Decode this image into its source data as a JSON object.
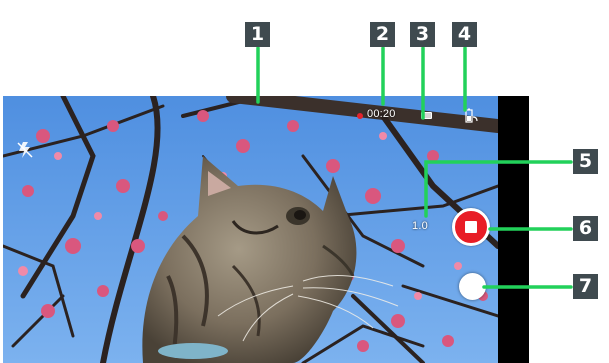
{
  "viewfinder": {
    "timer": "00:20",
    "zoom": "1.0"
  },
  "icons": {
    "flash": "flash-off-icon",
    "record": "recording-dot-icon",
    "storage": "storage-icon",
    "battery": "battery-icon",
    "stop": "stop-recording-icon",
    "snapshot": "shutter-snapshot-icon"
  },
  "callouts": [
    "1",
    "2",
    "3",
    "4",
    "5",
    "6",
    "7"
  ],
  "colors": {
    "callout_bg": "#3f4a4f",
    "leader": "#22d15a",
    "record_red": "#e81d26",
    "sky": "#5f9ce8"
  }
}
